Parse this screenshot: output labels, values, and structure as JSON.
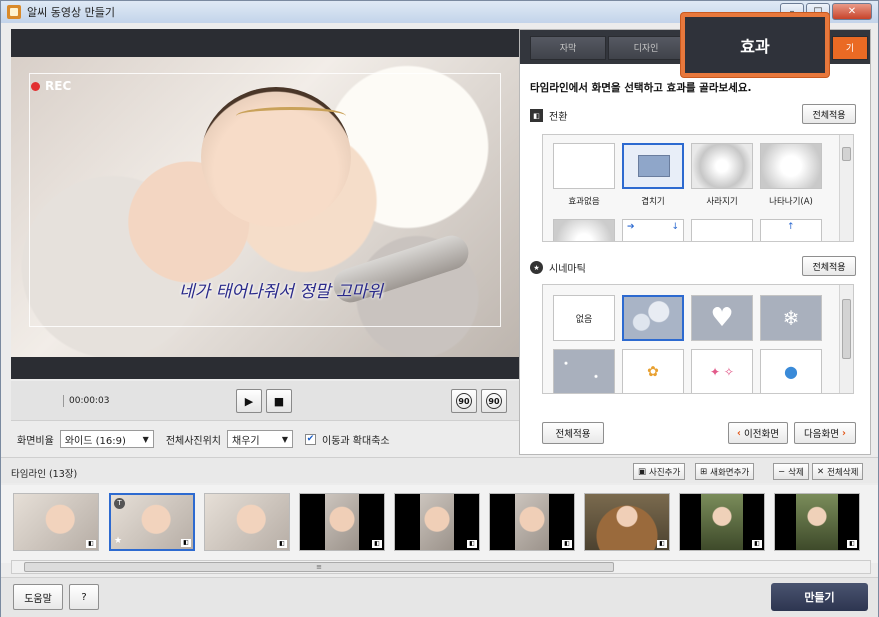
{
  "window": {
    "title": "알씨 동영상 만들기"
  },
  "preview": {
    "rec_label": "REC",
    "caption": "네가 태어나줘서 정말 고마워"
  },
  "controls": {
    "time": "00:00:03",
    "play_icon": "▶",
    "stop_icon": "■",
    "rotate_left": "90",
    "rotate_right": "90"
  },
  "settings": {
    "ratio_label": "화면비율",
    "ratio_value": "와이드 (16:9)",
    "photo_pos_label": "전체사진위치",
    "photo_pos_value": "채우기",
    "motion_label": "이동과 확대축소",
    "motion_checked": true
  },
  "panel": {
    "tabs": [
      "자막",
      "디자인",
      "효과",
      "기"
    ],
    "active_tab": "효과",
    "instruction": "타임라인에서 화면을 선택하고 효과를 골라보세요.",
    "transition": {
      "title": "전환",
      "apply_all": "전체적용",
      "items": [
        "효과없음",
        "겹치기",
        "사라지기",
        "나타나기(A)"
      ]
    },
    "cinemark": {
      "title": "시네마틱",
      "apply_all": "전체적용",
      "items": [
        "없음"
      ]
    },
    "apply_all_bottom": "전체적용",
    "prev_screen": "이전화면",
    "next_screen": "다음화면"
  },
  "timeline": {
    "title": "타임라인 (13장)",
    "add_photo": "사진추가",
    "add_screen": "새화면추가",
    "delete": "삭제",
    "delete_all": "전체삭제"
  },
  "footer": {
    "help": "도움말",
    "question": "?",
    "make": "만들기"
  },
  "colors": {
    "accent": "#e8783c",
    "selection": "#2d6ad0",
    "dark_tab": "#33363d",
    "make_button": "#2d3550"
  }
}
